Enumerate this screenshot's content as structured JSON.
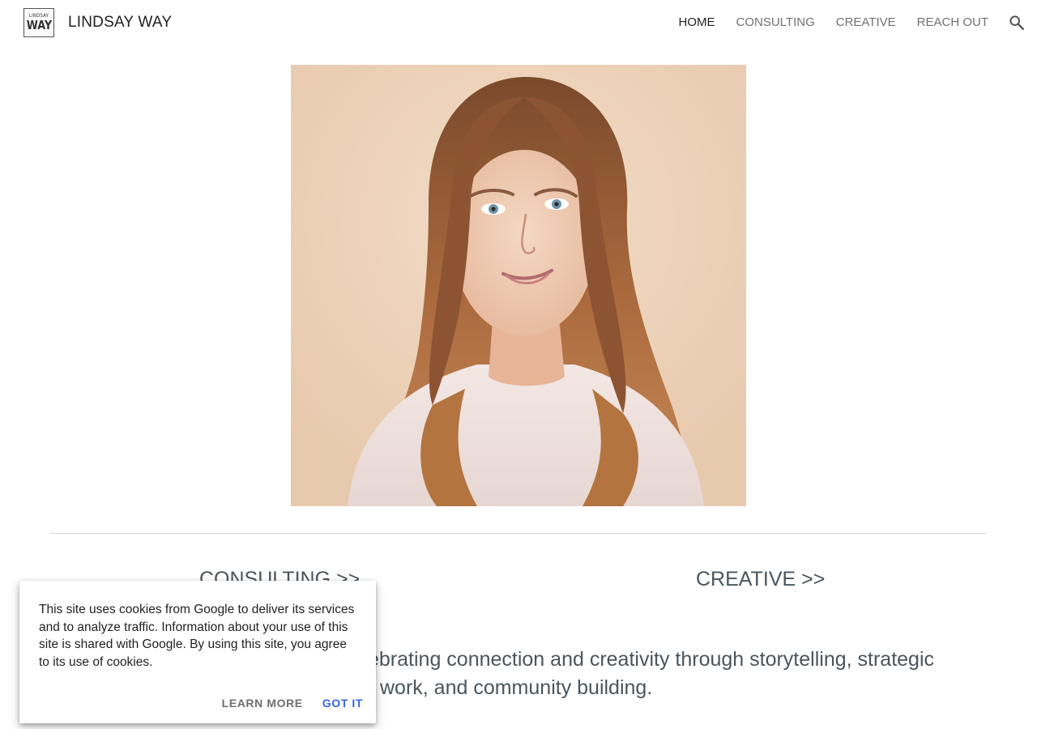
{
  "header": {
    "logo": {
      "top": "LINDSAY",
      "bottom": "WAY"
    },
    "site_title": "LINDSAY WAY",
    "nav": [
      {
        "label": "HOME",
        "active": true
      },
      {
        "label": "CONSULTING",
        "active": false
      },
      {
        "label": "CREATIVE",
        "active": false
      },
      {
        "label": "REACH OUT",
        "active": false
      }
    ],
    "search_icon": "search-icon"
  },
  "main": {
    "photo_subject": "portrait-photo",
    "links": {
      "consulting": "CONSULTING >>",
      "creative": "CREATIVE >>"
    },
    "intro_line1": "ebrating connection and creativity through storytelling, strategic",
    "intro_line2": "work, and community building."
  },
  "cookie_banner": {
    "text": "This site uses cookies from Google to deliver its services and to analyze traffic. Information about your use of this site is shared with Google. By using this site, you agree to its use of cookies.",
    "learn_more": "LEARN MORE",
    "got_it": "GOT IT"
  },
  "colors": {
    "accent": "#3367d6",
    "heading_text": "#4b555c",
    "nav_inactive": "#707070",
    "nav_active": "#212121"
  }
}
